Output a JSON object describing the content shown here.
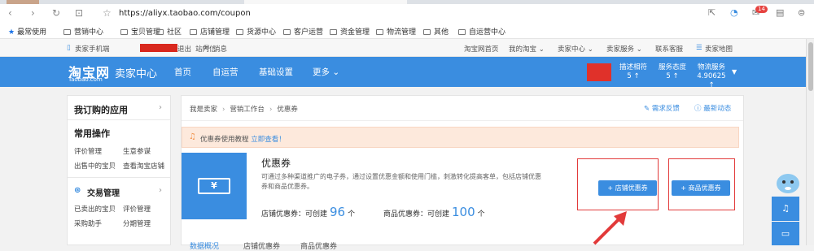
{
  "browser": {
    "url": "https://aliyx.taobao.com/coupon",
    "badge": "14"
  },
  "bookmarks": [
    {
      "label": "最常使用",
      "type": "star"
    },
    {
      "label": "营销中心"
    },
    {
      "label": "宝贝管理"
    },
    {
      "label": "社区"
    },
    {
      "label": "店铺管理"
    },
    {
      "label": "货源中心"
    },
    {
      "label": "客户运营"
    },
    {
      "label": "资金管理"
    },
    {
      "label": "物流管理"
    },
    {
      "label": "其他"
    },
    {
      "label": "自运营中心"
    }
  ],
  "site_bar": {
    "mobile": "卖家手机端",
    "logout": "退出",
    "mail": "站内信",
    "msg": "消息",
    "right": [
      "淘宝网首页",
      "我的淘宝 ⌄",
      "卖家中心 ⌄",
      "卖家服务 ⌄",
      "联系客服",
      "卖家地图"
    ]
  },
  "header": {
    "logo": "淘宝网",
    "logo_sub": "Taobao.com",
    "title": "卖家中心",
    "nav": [
      "首页",
      "自运营",
      "基础设置",
      "更多 ⌄"
    ],
    "stats": [
      {
        "label": "描述相符",
        "value": "5 ↑"
      },
      {
        "label": "服务态度",
        "value": "5 ↑"
      },
      {
        "label": "物流服务",
        "value": "4.90625 ↑"
      }
    ]
  },
  "sidebar": {
    "apps": "我订购的应用",
    "common": "常用操作",
    "common_links": [
      "评价管理",
      "生意参谋",
      "出售中的宝贝",
      "查看淘宝店铺"
    ],
    "trade": "交易管理",
    "trade_links": [
      "已卖出的宝贝",
      "评价管理",
      "采购助手",
      "分期管理"
    ]
  },
  "main": {
    "crumbs": [
      "我是卖家",
      "营销工作台",
      "优惠券"
    ],
    "feedback": "需求反馈",
    "news": "最新动态",
    "notice": "优惠券使用教程",
    "notice_link": "立即查看！",
    "coupon_title": "优惠券",
    "coupon_desc": "可通过多种渠道推广的电子券，通过设置优惠金额和使用门槛，刺激转化提高客单，包括店铺优惠券和商品优惠券。",
    "shop_label": "店铺优惠券：可创建",
    "shop_count": "96",
    "goods_label": "商品优惠券：可创建",
    "goods_count": "100",
    "unit": "个",
    "btn_shop": "+ 店铺优惠券",
    "btn_goods": "+ 商品优惠券",
    "tabs": [
      "数据概况",
      "店铺优惠券",
      "商品优惠券"
    ]
  },
  "colors": {
    "brand": "#3a8de0",
    "notice_bg": "#fde9dc",
    "highlight": "#e23a3a"
  }
}
